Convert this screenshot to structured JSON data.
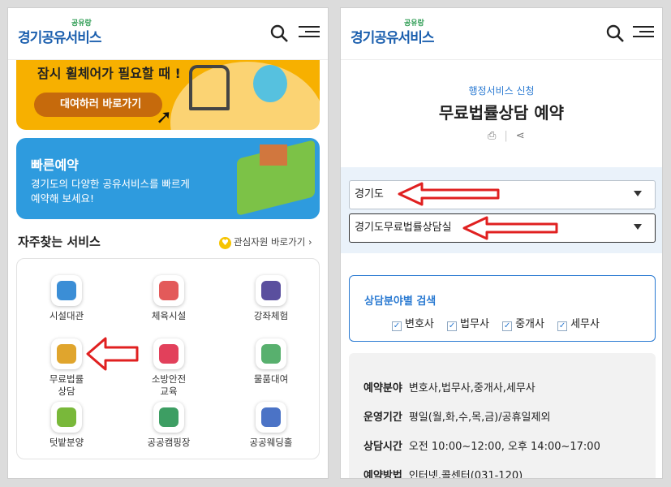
{
  "left": {
    "header": {
      "logo_main": "경기공유서비스",
      "logo_small": "공유랑"
    },
    "banner_rent": {
      "title": "잠시 휠체어가 필요할 때 !",
      "button_label": "대여하러 바로가기"
    },
    "banner_quick": {
      "title": "빠른예약",
      "description": "경기도의 다양한 공유서비스를 빠르게 예약해 보세요!"
    },
    "section": {
      "title": "자주찾는 서비스",
      "favorites_link": "관심자원 바로가기 ›"
    },
    "services": [
      {
        "label": "시설대관",
        "icon": "building-icon",
        "color": "#3b8ed6"
      },
      {
        "label": "체육시설",
        "icon": "racket-icon",
        "color": "#e35a5a"
      },
      {
        "label": "강좌체험",
        "icon": "lecture-icon",
        "color": "#5a4f9e"
      },
      {
        "label": "무료법률\n상담",
        "icon": "gavel-icon",
        "color": "#e0a52d"
      },
      {
        "label": "소방안전\n교육",
        "icon": "extinguisher-icon",
        "color": "#e2405b"
      },
      {
        "label": "물품대여",
        "icon": "box-icon",
        "color": "#58b06e"
      },
      {
        "label": "텃밭분양",
        "icon": "sprout-icon",
        "color": "#79b83a"
      },
      {
        "label": "공공캠핑장",
        "icon": "tent-icon",
        "color": "#3d9e63"
      },
      {
        "label": "공공웨딩홀",
        "icon": "wedding-icon",
        "color": "#4b73c6"
      }
    ]
  },
  "right": {
    "header": {
      "logo_main": "경기공유서비스",
      "logo_small": "공유랑"
    },
    "subtitle": "행정서비스 신청",
    "title": "무료법률상담 예약",
    "select_region": "경기도",
    "select_office": "경기도무료법률상담실",
    "filter": {
      "title": "상담분야별 검색",
      "options": [
        "변호사",
        "법무사",
        "중개사",
        "세무사"
      ]
    },
    "info": [
      {
        "label": "예약분야",
        "value": "변호사,법무사,중개사,세무사"
      },
      {
        "label": "운영기간",
        "value": "평일(월,화,수,목,금)/공휴일제외"
      },
      {
        "label": "상담시간",
        "value": "오전 10:00~12:00, 오후 14:00~17:00"
      },
      {
        "label": "예약방법",
        "value": "인터넷,콜센터(031-120)"
      }
    ]
  },
  "colors": {
    "accent_blue": "#2a7ad2",
    "annotation_red": "#e02020",
    "banner_yellow": "#f7b000",
    "banner_blue": "#2e9bde"
  }
}
